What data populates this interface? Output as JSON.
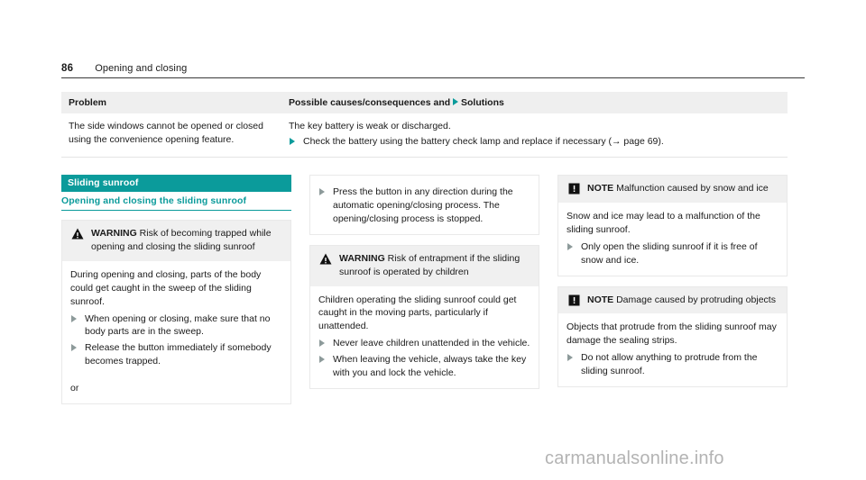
{
  "runhead": {
    "page_number": "86",
    "chapter": "Opening and closing"
  },
  "table": {
    "headers": {
      "col1": "Problem",
      "col2_before": "Possible causes/consequences and",
      "col2_after": "Solutions",
      "solution_arrow_icon": "triangle-right-icon"
    },
    "rows": [
      {
        "problem": "The side windows cannot be opened or closed using the convenience opening feature.",
        "cause": "The key battery is weak or discharged.",
        "solution": "Check the battery using the battery check lamp and replace if necessary (→ page 69)."
      }
    ]
  },
  "section": {
    "title": "Sliding sunroof",
    "subtitle": "Opening and closing the sliding sunroof"
  },
  "columns": {
    "left": {
      "warning": {
        "icon": "warning-triangle-icon",
        "label": "WARNING",
        "heading": "Risk of becoming trapped while opening and closing the sliding sunroof",
        "body": "During opening and closing, parts of the body could get caught in the sweep of the sliding sunroof.",
        "bullets": [
          "When opening or closing, make sure that no body parts are in the sweep.",
          "Release the button immediately if somebody becomes trapped."
        ],
        "trailing": "or"
      }
    },
    "middle": {
      "lead_bullet": "Press the button in any direction during the automatic opening/closing process. The opening/closing process is stopped.",
      "warning": {
        "icon": "warning-triangle-icon",
        "label": "WARNING",
        "heading": "Risk of entrapment if the sliding sunroof is operated by children",
        "body": "Children operating the sliding sunroof could get caught in the moving parts, particularly if unattended.",
        "bullets": [
          "Never leave children unattended in the vehicle.",
          "When leaving the vehicle, always take the key with you and lock the vehicle."
        ]
      }
    },
    "right": {
      "notes": [
        {
          "icon": "note-exclamation-icon",
          "label": "NOTE",
          "heading": "Malfunction caused by snow and ice",
          "body": "Snow and ice may lead to a malfunction of the sliding sunroof.",
          "bullets": [
            "Only open the sliding sunroof if it is free of snow and ice."
          ]
        },
        {
          "icon": "note-exclamation-icon",
          "label": "NOTE",
          "heading": "Damage caused by protruding objects",
          "body": "Objects that protrude from the sliding sunroof may damage the sealing strips.",
          "bullets": [
            "Do not allow anything to protrude from the sliding sunroof."
          ]
        }
      ]
    }
  },
  "watermark": {
    "text": "carmanualsonline.info"
  },
  "colors": {
    "accent_teal": "#0b9b9b",
    "header_gray": "#efefef",
    "bullet_gray": "#8d9a9a",
    "watermark_gray": "#b3b3b3"
  }
}
